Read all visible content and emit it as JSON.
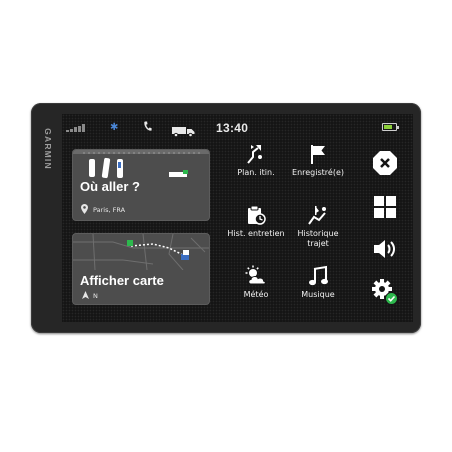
{
  "device": {
    "brand": "GARMIN"
  },
  "statusbar": {
    "time": "13:40",
    "bluetooth_icon": "bluetooth-icon",
    "phone_icon": "phone-icon",
    "truck_icon": "truck-icon"
  },
  "cards": {
    "where": {
      "title": "Où aller ?",
      "subtitle": "Paris, FRA",
      "icon": "location-pin-icon"
    },
    "map": {
      "title": "Afficher carte",
      "subtitle": "N",
      "icon": "north-arrow-icon"
    }
  },
  "menu": [
    {
      "label": "Plan. itin.",
      "icon": "route-planner-icon"
    },
    {
      "label": "Enregistré(e)",
      "icon": "flag-icon"
    },
    {
      "label": "Hist. entretien",
      "icon": "service-history-icon"
    },
    {
      "label": "Historique trajet",
      "icon": "trip-history-icon"
    },
    {
      "label": "Météo",
      "icon": "weather-icon"
    },
    {
      "label": "Musique",
      "icon": "music-icon"
    }
  ],
  "sidebar": [
    {
      "name": "close",
      "icon": "close-icon"
    },
    {
      "name": "apps",
      "icon": "apps-grid-icon"
    },
    {
      "name": "volume",
      "icon": "volume-icon"
    },
    {
      "name": "settings",
      "icon": "settings-icon"
    }
  ],
  "colors": {
    "accent_green": "#2db84d",
    "bluetooth_blue": "#4a86d6",
    "battery_green": "#8ccf3a"
  }
}
